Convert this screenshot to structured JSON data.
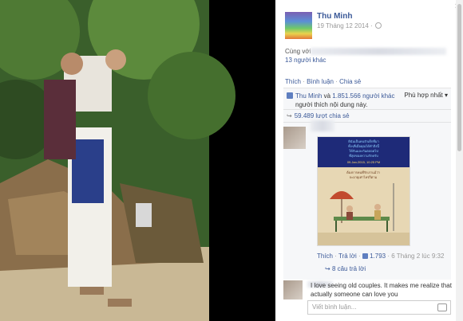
{
  "close_label": "×",
  "post": {
    "author": "Thu Minh",
    "date": "19 Tháng 12 2014 ·",
    "with_prefix": "Cùng với",
    "with_count": "13 người khác",
    "actions": {
      "like": "Thích",
      "comment": "Bình luận",
      "share": "Chia sẻ",
      "sep": "·"
    }
  },
  "likes": {
    "author": "Thu Minh",
    "text_mid": "và",
    "count": "1.851.566 người khác",
    "text_tail": "người thích nội dung này.",
    "sort_label": "Phù hợp nhất ▾",
    "shares": "59.489 lượt chia sẻ",
    "share_arrow": "↪"
  },
  "comment1": {
    "meme_top_lines": [
      "ดิฉันเป็นคนรักเด็กที่มา",
      "ทั้งๆที่เมื่อคุณได้ทำสิ่งนี้",
      "ให้กันและกันตลอดไป",
      "ที่สุดของความรักครับ"
    ],
    "meme_highlight": "09.Jan.2015, 10:25 PM",
    "meme_mid_lines": [
      "ต้องการคนที่รักเราแม้ว่า",
      "จะอายุเท่าไหร่ก็ตาม"
    ],
    "like": "Thích",
    "reply": "Trả lời",
    "count": "1.793",
    "time": "6 Tháng 2 lúc 9:32",
    "sep": "·",
    "replies": "8 câu trả lời",
    "reply_arrow": "↪"
  },
  "comment2": {
    "text": "I love seeing old couples. It makes me realize that actually someone can love you"
  },
  "write_placeholder": "Viết bình luận...",
  "icons": {
    "close": "close-icon",
    "globe": "globe-icon",
    "thumb": "thumbs-up-icon",
    "share": "share-icon",
    "reply": "reply-icon",
    "camera": "camera-icon"
  },
  "colors": {
    "link": "#3b5998",
    "panel_bg": "#ffffff",
    "like_box": "#f6f7f9"
  }
}
